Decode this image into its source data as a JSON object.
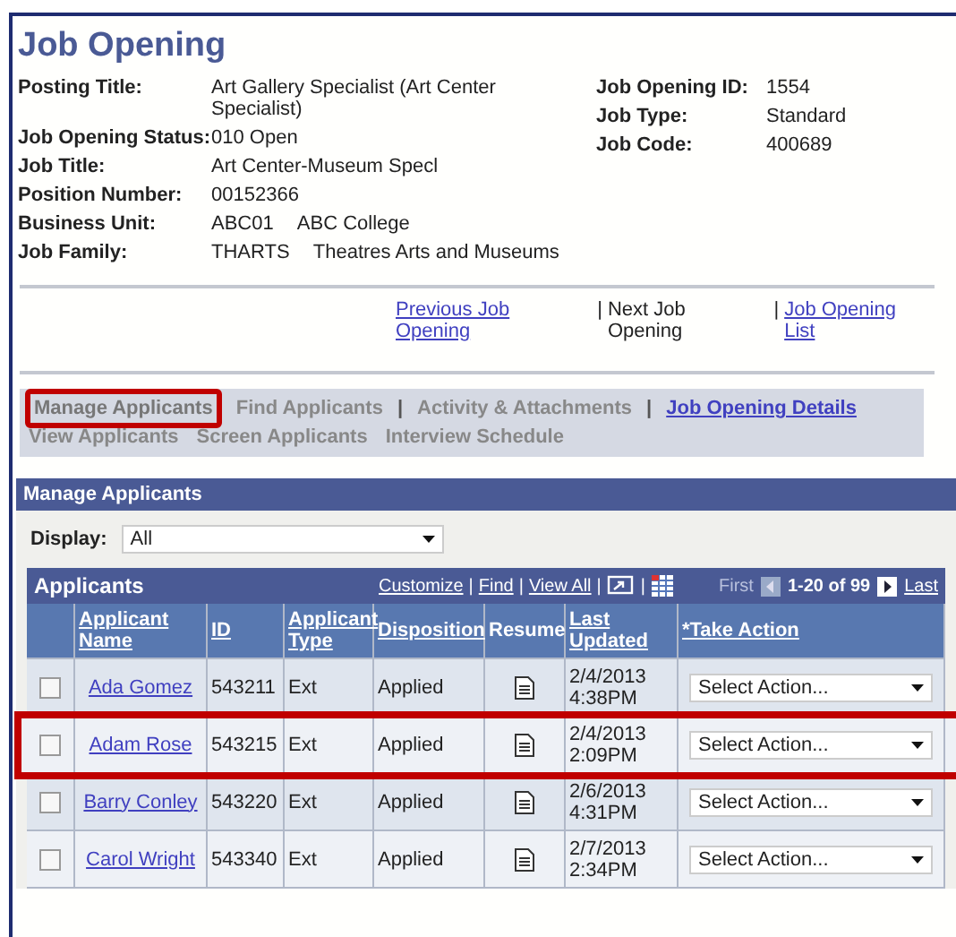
{
  "page_title": "Job Opening",
  "fields_left": [
    {
      "label": "Posting Title:",
      "value": "Art Gallery Specialist (Art Center Specialist)"
    },
    {
      "label": "Job Opening Status:",
      "value": "010 Open"
    },
    {
      "label": "Job Title:",
      "value": "Art Center-Museum Specl"
    },
    {
      "label": "Position Number:",
      "value": "00152366"
    },
    {
      "label": "Business Unit:",
      "value": "ABC01",
      "value_2": "ABC College"
    },
    {
      "label": "Job Family:",
      "value": "THARTS",
      "value_2": "Theatres Arts and Museums"
    }
  ],
  "fields_right": [
    {
      "label": "Job Opening ID:",
      "value": "1554"
    },
    {
      "label": "Job Type:",
      "value": "Standard"
    },
    {
      "label": "Job Code:",
      "value": "400689"
    }
  ],
  "nav_links": [
    {
      "label": "Previous Job Opening",
      "kind": "link"
    },
    {
      "label": "|",
      "kind": "separator"
    },
    {
      "label": "Next Job Opening",
      "kind": "plain"
    },
    {
      "label": "|",
      "kind": "separator"
    },
    {
      "label": "Job Opening List",
      "kind": "link"
    }
  ],
  "tab_rows": [
    [
      {
        "label": "Manage Applicants",
        "kind": "tab",
        "selected": true,
        "highlighted": true
      },
      {
        "label": "Find Applicants",
        "kind": "tab",
        "selected": false,
        "highlighted": false
      },
      {
        "label": "|",
        "kind": "separator"
      },
      {
        "label": "Activity & Attachments",
        "kind": "tab",
        "selected": false,
        "highlighted": false
      },
      {
        "label": "|",
        "kind": "separator"
      },
      {
        "label": "Job Opening Details",
        "kind": "link",
        "selected": false,
        "highlighted": false
      }
    ],
    [
      {
        "label": "View Applicants",
        "kind": "tab",
        "selected": false,
        "highlighted": false
      },
      {
        "label": "Screen Applicants",
        "kind": "tab",
        "selected": false,
        "highlighted": false
      },
      {
        "label": "Interview Schedule",
        "kind": "tab",
        "selected": false,
        "highlighted": false
      }
    ]
  ],
  "section_title": "Manage Applicants",
  "display": {
    "label": "Display:",
    "value": "All"
  },
  "grid": {
    "title": "Applicants",
    "tools": [
      {
        "label": "Customize",
        "kind": "link"
      },
      {
        "label": "|",
        "kind": "separator"
      },
      {
        "label": "Find",
        "kind": "link"
      },
      {
        "label": "|",
        "kind": "separator"
      },
      {
        "label": "View All",
        "kind": "link"
      },
      {
        "label": "|",
        "kind": "separator"
      },
      {
        "kind": "zoom-icon"
      },
      {
        "label": "|",
        "kind": "separator"
      },
      {
        "kind": "download-icon"
      }
    ],
    "pager": {
      "first": "First",
      "range": "1-20 of 99",
      "last": "Last"
    },
    "columns": [
      "",
      "Applicant Name",
      "ID",
      "Applicant Type",
      "Disposition",
      "Resume",
      "Last Updated",
      "*Take Action"
    ],
    "rows": [
      {
        "checked": false,
        "highlighted": false,
        "name": "Ada Gomez",
        "id": "543211",
        "type": "Ext",
        "disposition": "Applied",
        "updated": "2/4/2013 4:38PM",
        "action": "Select Action..."
      },
      {
        "checked": false,
        "highlighted": true,
        "name": "Adam Rose",
        "id": "543215",
        "type": "Ext",
        "disposition": "Applied",
        "updated": "2/4/2013 2:09PM",
        "action": "Select Action..."
      },
      {
        "checked": false,
        "highlighted": false,
        "name": "Barry Conley",
        "id": "543220",
        "type": "Ext",
        "disposition": "Applied",
        "updated": "2/6/2013 4:31PM",
        "action": "Select Action..."
      },
      {
        "checked": false,
        "highlighted": false,
        "name": "Carol Wright",
        "id": "543340",
        "type": "Ext",
        "disposition": "Applied",
        "updated": "2/7/2013 2:34PM",
        "action": "Select Action..."
      }
    ]
  }
}
